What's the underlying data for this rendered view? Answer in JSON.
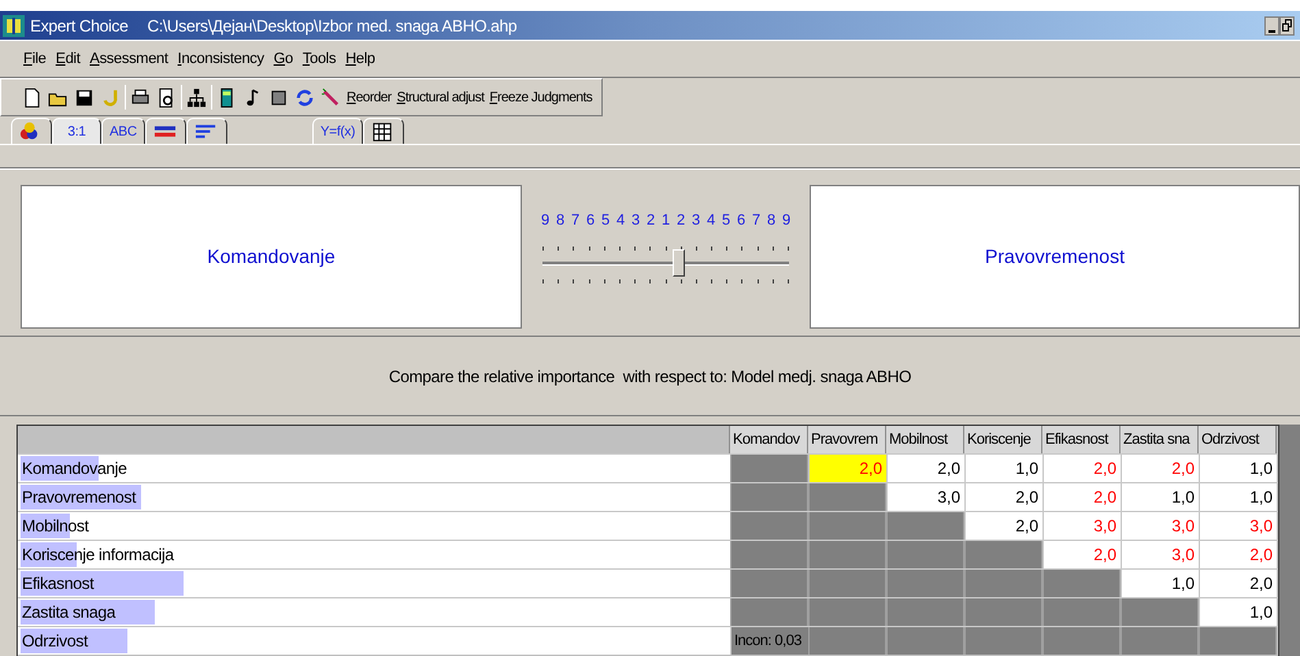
{
  "window": {
    "app_name": "Expert Choice",
    "title": "C:\\Users\\Дејан\\Desktop\\Izbor med. snaga ABHO.ahp"
  },
  "menu": [
    "File",
    "Edit",
    "Assessment",
    "Inconsistency",
    "Go",
    "Tools",
    "Help"
  ],
  "toolbar": {
    "text_buttons": [
      "Reorder",
      "Structural adjust",
      "Freeze Judgments"
    ]
  },
  "tabs": [
    {
      "kind": "icon",
      "selected": false
    },
    {
      "label": "3:1",
      "selected": true
    },
    {
      "label": "ABC",
      "selected": false
    },
    {
      "kind": "icon",
      "selected": false
    },
    {
      "kind": "icon",
      "selected": false
    },
    {
      "label": "Y=f(x)",
      "selected": false
    },
    {
      "kind": "icon",
      "selected": false
    }
  ],
  "comparison": {
    "left": "Komandovanje",
    "right": "Pravovremenost",
    "scale": [
      "9",
      "8",
      "7",
      "6",
      "5",
      "4",
      "3",
      "2",
      "1",
      "2",
      "3",
      "4",
      "5",
      "6",
      "7",
      "8",
      "9"
    ],
    "slider": {
      "level": 0.55
    },
    "prompt": "Compare the relative importance  with respect to: Model medj. snaga ABHO"
  },
  "table": {
    "columns": [
      "Komandov",
      "Pravovrem",
      "Mobilnost",
      "Koriscenje",
      "Efikasnost",
      "Zastita sna",
      "Odrzivost"
    ],
    "rows": [
      {
        "name": "Komandovanje",
        "level": 0.11,
        "cells": [
          {
            "kind": "blank"
          },
          {
            "kind": "judgment",
            "value": "2,0",
            "inverse": true,
            "selected": true
          },
          {
            "kind": "judgment",
            "value": "2,0",
            "inverse": false,
            "selected": false
          },
          {
            "kind": "judgment",
            "value": "1,0",
            "inverse": false,
            "selected": false
          },
          {
            "kind": "judgment",
            "value": "2,0",
            "inverse": true,
            "selected": false
          },
          {
            "kind": "judgment",
            "value": "2,0",
            "inverse": true,
            "selected": false
          },
          {
            "kind": "judgment",
            "value": "1,0",
            "inverse": false,
            "selected": false
          }
        ]
      },
      {
        "name": "Pravovremenost",
        "level": 0.17,
        "cells": [
          {
            "kind": "blank"
          },
          {
            "kind": "blank"
          },
          {
            "kind": "judgment",
            "value": "3,0",
            "inverse": false,
            "selected": false
          },
          {
            "kind": "judgment",
            "value": "2,0",
            "inverse": false,
            "selected": false
          },
          {
            "kind": "judgment",
            "value": "2,0",
            "inverse": true,
            "selected": false
          },
          {
            "kind": "judgment",
            "value": "1,0",
            "inverse": false,
            "selected": false
          },
          {
            "kind": "judgment",
            "value": "1,0",
            "inverse": false,
            "selected": false
          }
        ]
      },
      {
        "name": "Mobilnost",
        "level": 0.07,
        "cells": [
          {
            "kind": "blank"
          },
          {
            "kind": "blank"
          },
          {
            "kind": "blank"
          },
          {
            "kind": "judgment",
            "value": "2,0",
            "inverse": false,
            "selected": false
          },
          {
            "kind": "judgment",
            "value": "3,0",
            "inverse": true,
            "selected": false
          },
          {
            "kind": "judgment",
            "value": "3,0",
            "inverse": true,
            "selected": false
          },
          {
            "kind": "judgment",
            "value": "3,0",
            "inverse": true,
            "selected": false
          }
        ]
      },
      {
        "name": "Koriscenje informacija",
        "level": 0.08,
        "cells": [
          {
            "kind": "blank"
          },
          {
            "kind": "blank"
          },
          {
            "kind": "blank"
          },
          {
            "kind": "blank"
          },
          {
            "kind": "judgment",
            "value": "2,0",
            "inverse": true,
            "selected": false
          },
          {
            "kind": "judgment",
            "value": "3,0",
            "inverse": true,
            "selected": false
          },
          {
            "kind": "judgment",
            "value": "2,0",
            "inverse": true,
            "selected": false
          }
        ]
      },
      {
        "name": "Efikasnost",
        "level": 0.23,
        "cells": [
          {
            "kind": "blank"
          },
          {
            "kind": "blank"
          },
          {
            "kind": "blank"
          },
          {
            "kind": "blank"
          },
          {
            "kind": "blank"
          },
          {
            "kind": "judgment",
            "value": "1,0",
            "inverse": false,
            "selected": false
          },
          {
            "kind": "judgment",
            "value": "2,0",
            "inverse": false,
            "selected": false
          }
        ]
      },
      {
        "name": "Zastita snaga",
        "level": 0.19,
        "cells": [
          {
            "kind": "blank"
          },
          {
            "kind": "blank"
          },
          {
            "kind": "blank"
          },
          {
            "kind": "blank"
          },
          {
            "kind": "blank"
          },
          {
            "kind": "blank"
          },
          {
            "kind": "judgment",
            "value": "1,0",
            "inverse": false,
            "selected": false
          }
        ]
      },
      {
        "name": "Odrzivost",
        "level": 0.15,
        "cells": [
          {
            "kind": "note",
            "value": "Incon: 0,03"
          },
          {
            "kind": "blank"
          },
          {
            "kind": "blank"
          },
          {
            "kind": "blank"
          },
          {
            "kind": "blank"
          },
          {
            "kind": "blank"
          },
          {
            "kind": "blank"
          }
        ]
      }
    ]
  }
}
